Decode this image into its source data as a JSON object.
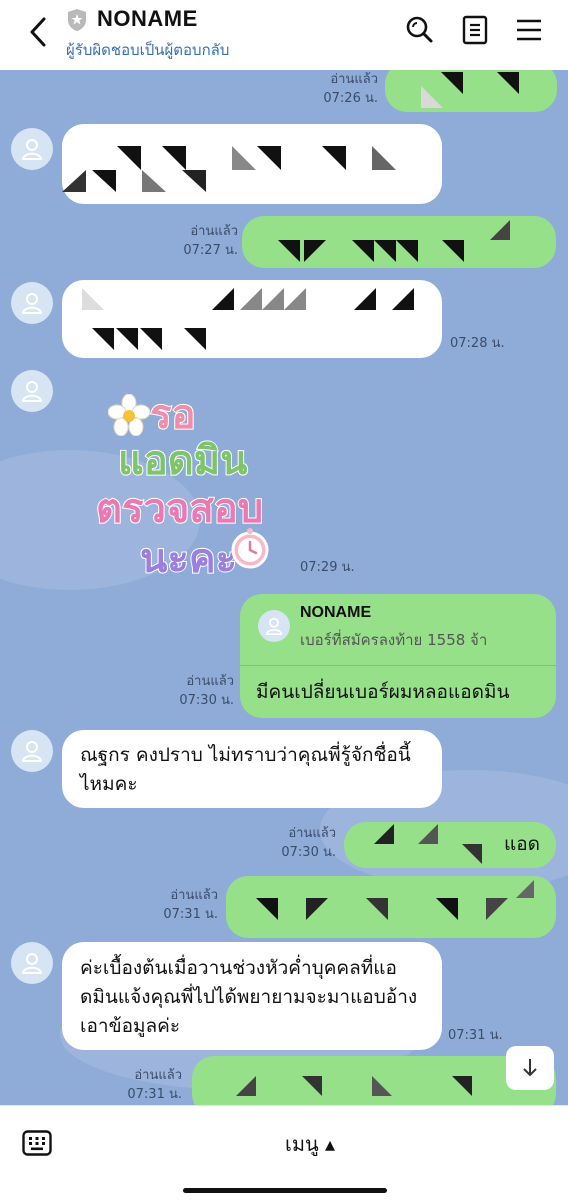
{
  "header": {
    "title": "NONAME",
    "subtitle": "ผู้รับผิดชอบเป็นผู้ตอบกลับ"
  },
  "messages": {
    "m1_read": "อ่านแล้ว",
    "m1_time": "07:26 น.",
    "m2_read": "อ่านแล้ว",
    "m2_time": "07:27 น.",
    "m3_time": "07:28 น.",
    "sticker_time": "07:29 น.",
    "sticker_lines": [
      "รอ",
      "แอดมิน",
      "ตรวจสอบ",
      "นะคะ"
    ],
    "reply_quote_name": "NONAME",
    "reply_quote_text": "เบอร์ที่สมัครลงท้าย 1558 จ้า",
    "reply_text": "มีคนเปลี่ยนเบอร์ผมหลอแอดมิน",
    "reply_read": "อ่านแล้ว",
    "reply_time": "07:30 น.",
    "in_msg1": "ณฐกร คงปราบ ไม่ทราบว่าคุณพี่รู้จักชื่อนี้ไหมคะ",
    "out_partial_suffix": "แอด",
    "out_partial_read": "อ่านแล้ว",
    "out_partial_time": "07:30 น.",
    "out_msg5_read": "อ่านแล้ว",
    "out_msg5_time": "07:31 น.",
    "in_msg2": "ค่ะเบื้องต้นเมื่อวานช่วงหัวค่ำบุคคลที่แอดมินแจ้งคุณพี่ไปได้พยายามจะมาแอบอ้างเอาข้อมูลค่ะ",
    "in_msg2_time": "07:31 น.",
    "last_read": "อ่านแล้ว",
    "last_time": "07:31 น."
  },
  "bottom": {
    "menu_label": "เมนู ▴"
  }
}
